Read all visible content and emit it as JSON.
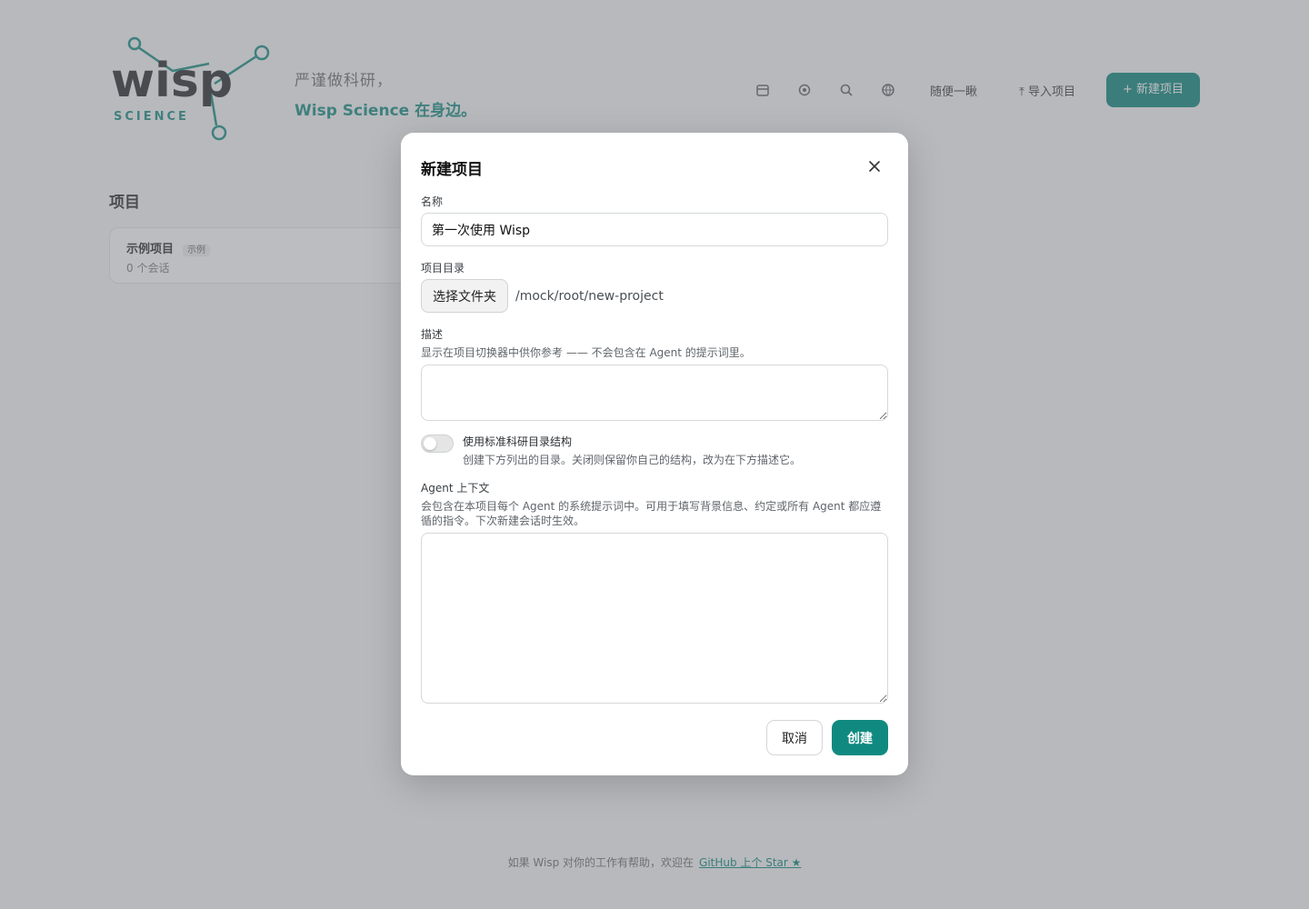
{
  "background": {
    "logo_text": "wisp",
    "logo_subtext": "SCIENCE",
    "tagline_line1": "严谨做科研，",
    "tagline_line2": "Wisp Science 在身边。",
    "toolbar": {
      "try_button": "随便一瞅",
      "import_button": "导入项目",
      "new_project_button": "+ 新建项目"
    },
    "section_title": "项目",
    "project_card": {
      "name": "示例项目",
      "badge": "示例",
      "subtitle": "0 个会话"
    },
    "footer": {
      "text": "如果 Wisp 对你的工作有帮助，欢迎在",
      "link": "GitHub 上个 Star ★"
    }
  },
  "modal": {
    "title": "新建项目",
    "name_label": "名称",
    "name_value": "第一次使用 Wisp",
    "dir_label": "项目目录",
    "choose_folder_button": "选择文件夹",
    "dir_path": "/mock/root/new-project",
    "description_label": "描述",
    "description_hint": "显示在项目切换器中供你参考 —— 不会包含在 Agent 的提示词里。",
    "description_value": "",
    "toggle_label": "使用标准科研目录结构",
    "toggle_hint": "创建下方列出的目录。关闭则保留你自己的结构，改为在下方描述它。",
    "toggle_on": false,
    "context_label": "Agent 上下文",
    "context_hint": "会包含在本项目每个 Agent 的系统提示词中。可用于填写背景信息、约定或所有 Agent 都应遵循的指令。下次新建会话时生效。",
    "context_value": "",
    "cancel_button": "取消",
    "create_button": "创建"
  },
  "colors": {
    "accent": "#108a80",
    "overlay": "rgba(110,112,118,0.46)"
  }
}
